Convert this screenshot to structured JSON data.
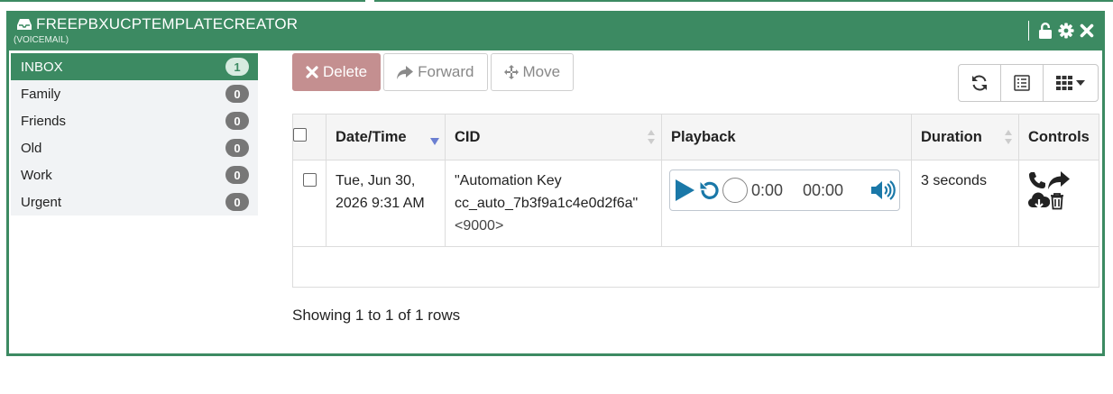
{
  "widget": {
    "title": "FREEPBXUCPTEMPLATECREATOR",
    "subtitle": "(VOICEMAIL)"
  },
  "folders": [
    {
      "label": "INBOX",
      "count": "1",
      "active": true
    },
    {
      "label": "Family",
      "count": "0"
    },
    {
      "label": "Friends",
      "count": "0"
    },
    {
      "label": "Old",
      "count": "0"
    },
    {
      "label": "Work",
      "count": "0"
    },
    {
      "label": "Urgent",
      "count": "0"
    }
  ],
  "toolbar": {
    "delete_label": "Delete",
    "forward_label": "Forward",
    "move_label": "Move"
  },
  "table": {
    "headers": {
      "datetime": "Date/Time",
      "cid": "CID",
      "playback": "Playback",
      "duration": "Duration",
      "controls": "Controls"
    },
    "rows": [
      {
        "date_line1": "Tue, Jun 30,",
        "date_line2": "2026 9:31 AM",
        "cid_name": "\"Automation Key",
        "cid_name2": "cc_auto_7b3f9a1c4e0d2f6a\"",
        "cid_number": "<9000>",
        "current_time": "0:00",
        "total_time": "00:00",
        "duration": "3 seconds"
      }
    ]
  },
  "footer": {
    "info": "Showing 1 to 1 of 1 rows"
  },
  "colors": {
    "accent": "#3c8a62",
    "delete_button": "#c48f90",
    "player_icon": "#1a78a8"
  },
  "icons": [
    "inbox-icon",
    "lock-icon",
    "gear-icon",
    "close-icon",
    "refresh-icon",
    "list-icon",
    "columns-grid-icon",
    "caret-down-icon",
    "sort-desc-icon",
    "sort-icon",
    "play-icon",
    "restart-icon",
    "volume-icon",
    "phone-icon",
    "share-icon",
    "download-icon",
    "trash-icon"
  ]
}
